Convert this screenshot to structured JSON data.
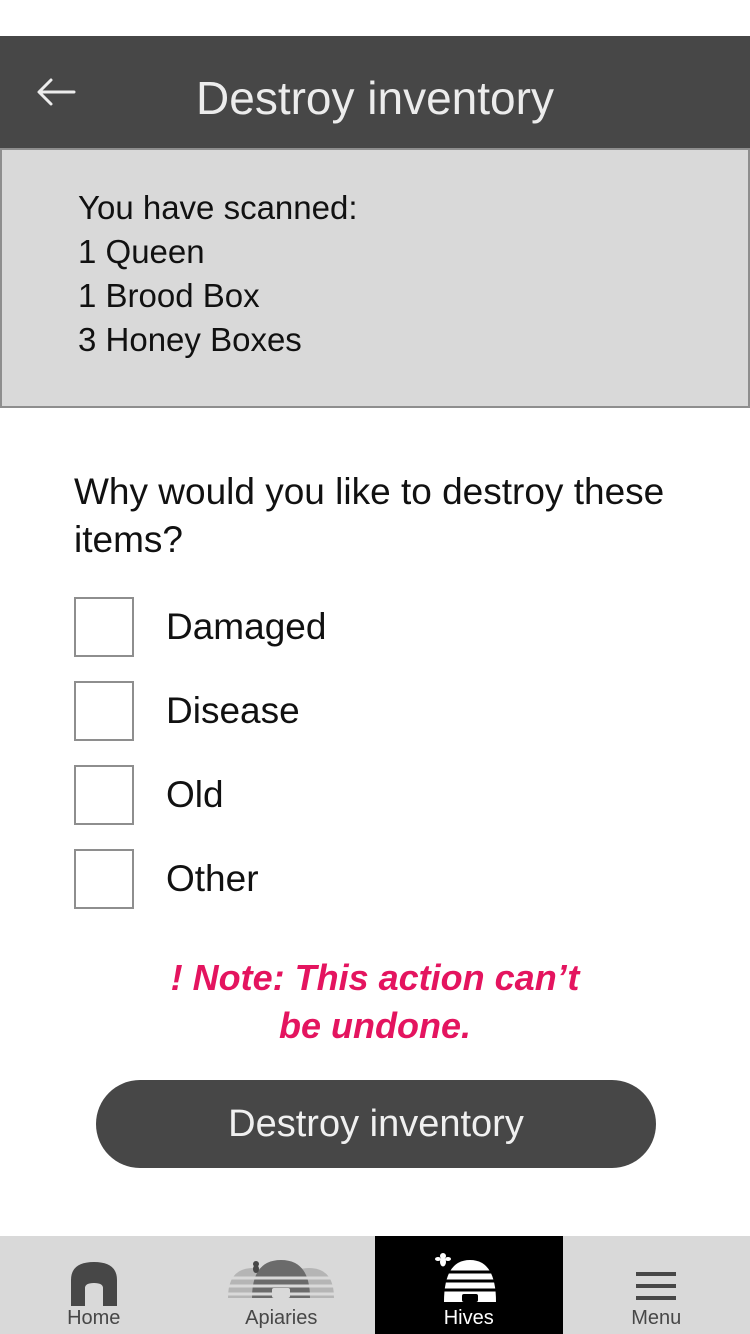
{
  "header": {
    "title": "Destroy inventory"
  },
  "summary": {
    "heading": "You have scanned:",
    "items": [
      "1 Queen",
      "1 Brood Box",
      "3 Honey Boxes"
    ]
  },
  "question": "Why would you like to destroy these items?",
  "options": [
    {
      "label": "Damaged",
      "checked": false
    },
    {
      "label": "Disease",
      "checked": false
    },
    {
      "label": "Old",
      "checked": false
    },
    {
      "label": "Other",
      "checked": false
    }
  ],
  "warning": {
    "line1": "! Note: This action can’t",
    "line2": "be undone."
  },
  "action_button": {
    "label": "Destroy inventory"
  },
  "tabs": [
    {
      "label": "Home",
      "icon": "home-icon",
      "active": false
    },
    {
      "label": "Apiaries",
      "icon": "apiaries-icon",
      "active": false
    },
    {
      "label": "Hives",
      "icon": "hive-icon",
      "active": true
    },
    {
      "label": "Menu",
      "icon": "menu-icon",
      "active": false
    }
  ],
  "colors": {
    "header_bg": "#474747",
    "panel_bg": "#d9d9d9",
    "warning": "#e4145f",
    "active_tab": "#000000"
  }
}
